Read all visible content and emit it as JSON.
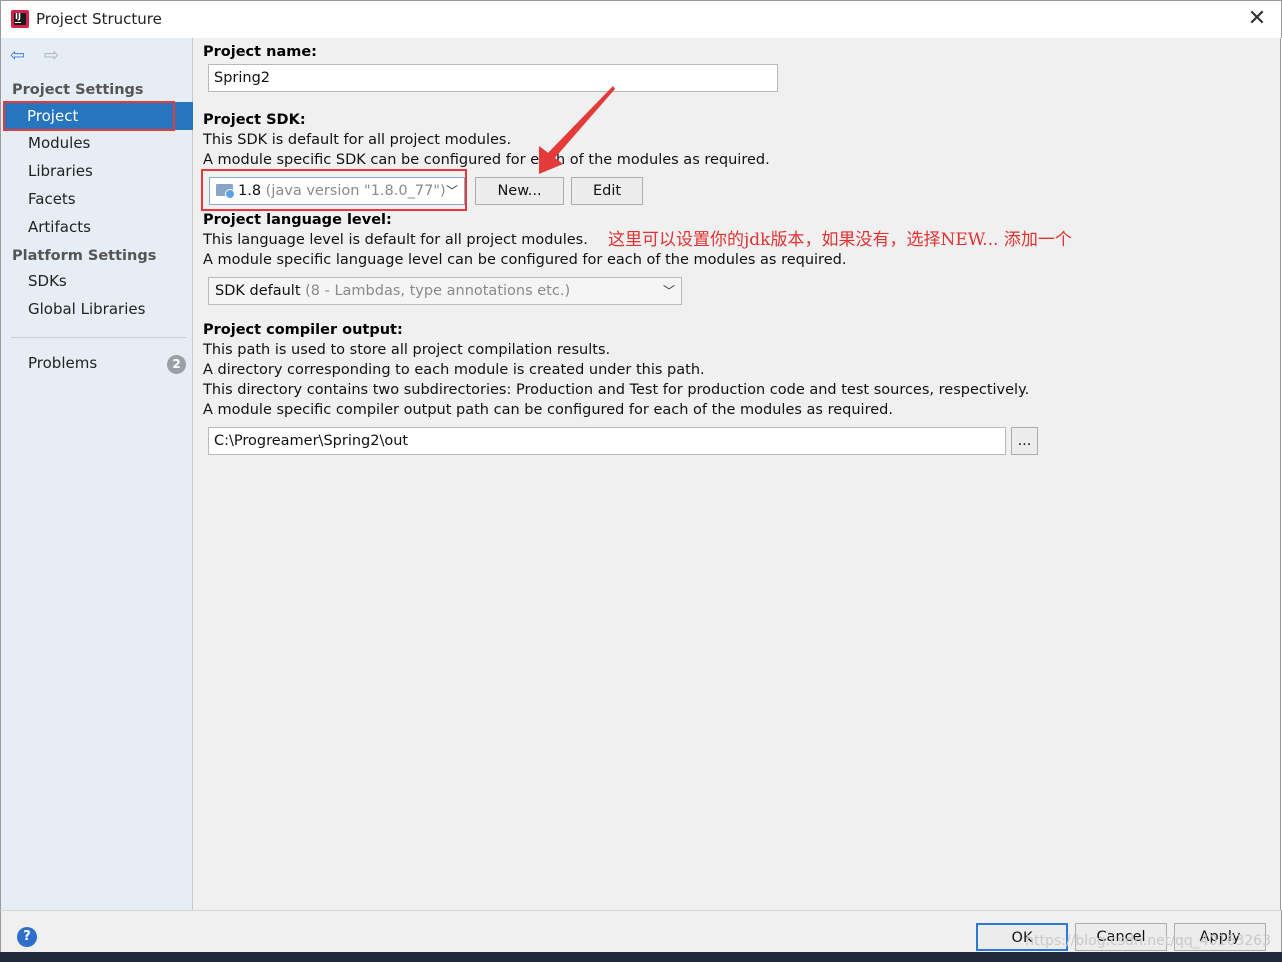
{
  "window": {
    "title": "Project Structure",
    "close_glyph": "✕"
  },
  "sidebar": {
    "back_glyph": "⇦",
    "forward_glyph": "⇨",
    "project_settings_label": "Project Settings",
    "project_settings_items": [
      {
        "label": "Project",
        "selected": true
      },
      {
        "label": "Modules"
      },
      {
        "label": "Libraries"
      },
      {
        "label": "Facets"
      },
      {
        "label": "Artifacts"
      }
    ],
    "platform_settings_label": "Platform Settings",
    "platform_settings_items": [
      {
        "label": "SDKs"
      },
      {
        "label": "Global Libraries"
      }
    ],
    "problems_label": "Problems",
    "problems_count": "2"
  },
  "project": {
    "name_label": "Project name:",
    "name_value": "Spring2",
    "sdk_label": "Project SDK:",
    "sdk_desc_1": "This SDK is default for all project modules.",
    "sdk_desc_2": "A module specific SDK can be configured for each of the modules as required.",
    "sdk_selected_main": "1.8",
    "sdk_selected_detail": "(java version \"1.8.0_77\")",
    "new_button": "New...",
    "edit_button": "Edit",
    "lang_label": "Project language level:",
    "lang_desc_1": "This language level is default for all project modules.",
    "lang_desc_2": "A module specific language level can be configured for each of the modules as required.",
    "lang_selected_main": "SDK default",
    "lang_selected_detail": "(8 - Lambdas, type annotations etc.)",
    "output_label": "Project compiler output:",
    "output_desc_1": "This path is used to store all project compilation results.",
    "output_desc_2": "A directory corresponding to each module is created under this path.",
    "output_desc_3": "This directory contains two subdirectories: Production and Test for production code and test sources, respectively.",
    "output_desc_4": "A module specific compiler output path can be configured for each of the modules as required.",
    "output_path": "C:\\Progreamer\\Spring2\\out",
    "browse_button": "..."
  },
  "annotation_text": "这里可以设置你的jdk版本，如果没有，选择NEW... 添加一个",
  "footer": {
    "help_glyph": "?",
    "ok_button": "OK",
    "cancel_button": "Cancel",
    "apply_button": "Apply",
    "watermark": "https://blog.csdn.net/qq_40163263"
  },
  "colors": {
    "selection": "#2675bf",
    "annotation_red": "#e53a3a",
    "sidebar_bg": "#e7edf5"
  }
}
